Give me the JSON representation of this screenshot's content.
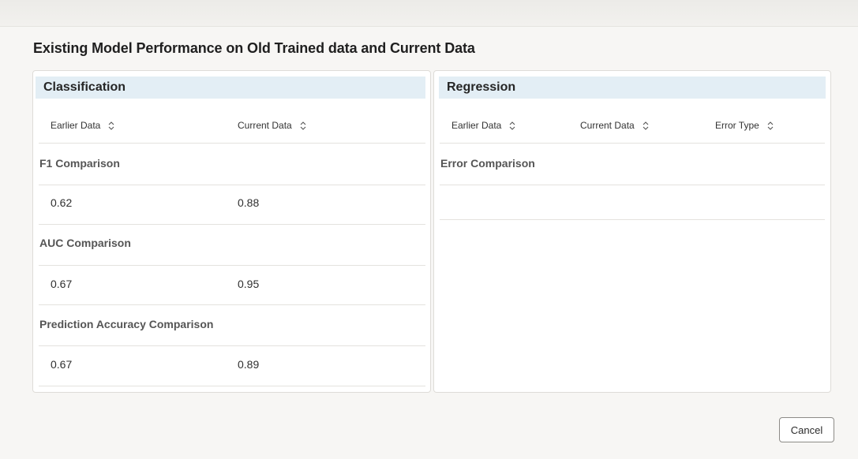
{
  "dialog": {
    "title": "Existing Model Performance on Old Trained data and Current Data",
    "cancel_label": "Cancel"
  },
  "classification": {
    "title": "Classification",
    "columns": [
      "Earlier Data",
      "Current Data"
    ],
    "groups": [
      {
        "label": "F1 Comparison",
        "earlier": "0.62",
        "current": "0.88"
      },
      {
        "label": "AUC Comparison",
        "earlier": "0.67",
        "current": "0.95"
      },
      {
        "label": "Prediction Accuracy Comparison",
        "earlier": "0.67",
        "current": "0.89"
      }
    ]
  },
  "regression": {
    "title": "Regression",
    "columns": [
      "Earlier Data",
      "Current Data",
      "Error Type"
    ],
    "groups": [
      {
        "label": "Error Comparison"
      }
    ]
  },
  "icons": {
    "sort": "sort-icon"
  }
}
